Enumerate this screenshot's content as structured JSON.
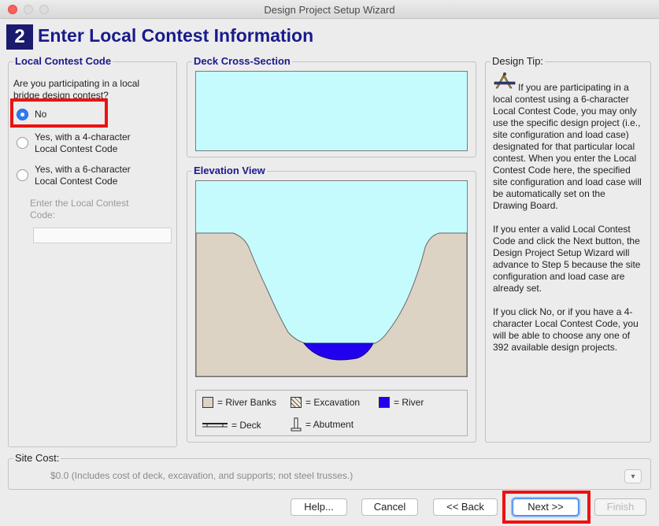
{
  "window": {
    "title": "Design Project Setup Wizard"
  },
  "header": {
    "step_number": "2",
    "title": "Enter Local Contest Information"
  },
  "contest_code": {
    "group_title": "Local Contest Code",
    "question": "Are you participating in a local bridge design contest?",
    "options": [
      {
        "label": "No",
        "selected": true
      },
      {
        "label": "Yes, with a 4-character Local Contest Code",
        "selected": false
      },
      {
        "label": "Yes, with a 6-character Local Contest Code",
        "selected": false
      }
    ],
    "code_prompt": "Enter the Local Contest Code:",
    "code_value": ""
  },
  "deck": {
    "group_title": "Deck Cross-Section"
  },
  "elevation": {
    "group_title": "Elevation View",
    "legend": {
      "river_banks": "= River Banks",
      "excavation": "= Excavation",
      "river": "= River",
      "deck": "= Deck",
      "abutment": "= Abutment"
    },
    "colors": {
      "sky": "#c6fbfd",
      "banks": "#ddd3c4",
      "river": "#2200ee"
    }
  },
  "tip": {
    "group_title": "Design Tip:",
    "paragraphs": [
      "If you are participating in a local contest using a 6-character Local Contest Code, you may only use the specific design project (i.e., site configuration and load case) designated for that particular local contest. When you enter the Local Contest Code here, the specified site configuration and load case will be automatically set on the Drawing Board.",
      "If you enter a valid Local Contest Code and click the Next button, the Design Project Setup Wizard will advance to Step 5 because the site configuration and load case are already set.",
      "If you click No, or if you have a 4-character Local Contest Code, you will be able to choose any one of 392 available design projects."
    ]
  },
  "site_cost": {
    "group_title": "Site Cost:",
    "text": "$0.0 (Includes cost of deck, excavation, and supports; not steel trusses.)",
    "toggle_glyph": "▾"
  },
  "buttons": {
    "help": "Help...",
    "cancel": "Cancel",
    "back": "<< Back",
    "next": "Next >>",
    "finish": "Finish"
  }
}
